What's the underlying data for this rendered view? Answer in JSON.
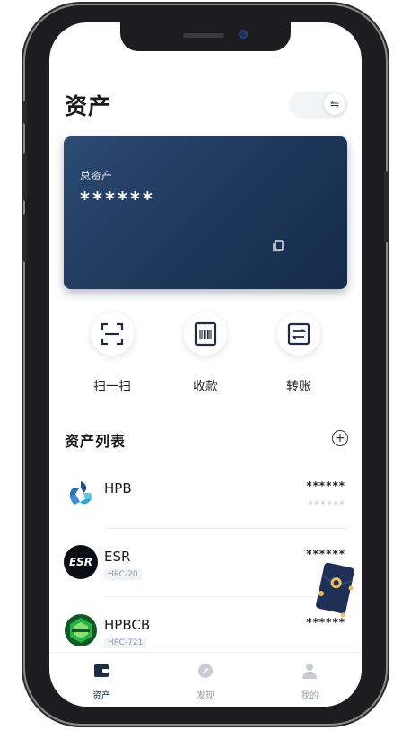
{
  "header": {
    "title": "资产",
    "toggle_icon": "swap-icon",
    "toggle_glyph": "⇋"
  },
  "asset_card": {
    "label": "总资产",
    "value": "******",
    "copy_icon": "copy-icon"
  },
  "actions": [
    {
      "label": "扫一扫",
      "icon": "scan-icon"
    },
    {
      "label": "收款",
      "icon": "barcode-icon"
    },
    {
      "label": "转账",
      "icon": "transfer-icon"
    }
  ],
  "asset_list": {
    "title": "资产列表",
    "add_glyph": "+",
    "items": [
      {
        "name": "HPB",
        "tag": "",
        "amount": "******",
        "amount_secondary": "******",
        "logo": "hpb-logo"
      },
      {
        "name": "ESR",
        "tag": "HRC-20",
        "amount": "******",
        "amount_secondary": "",
        "logo": "esr-logo",
        "logo_text": "ESR"
      },
      {
        "name": "HPBCB",
        "tag": "HRC-721",
        "amount": "******",
        "amount_secondary": "",
        "logo": "hpbcb-logo"
      }
    ]
  },
  "tabbar": [
    {
      "label": "资产",
      "icon": "wallet-icon",
      "active": true
    },
    {
      "label": "发现",
      "icon": "compass-icon",
      "active": false
    },
    {
      "label": "我的",
      "icon": "person-icon",
      "active": false
    }
  ],
  "colors": {
    "card_start": "#2c4a73",
    "card_end": "#172b49",
    "accent": "#1d2b45",
    "muted": "#9aa0a8"
  }
}
